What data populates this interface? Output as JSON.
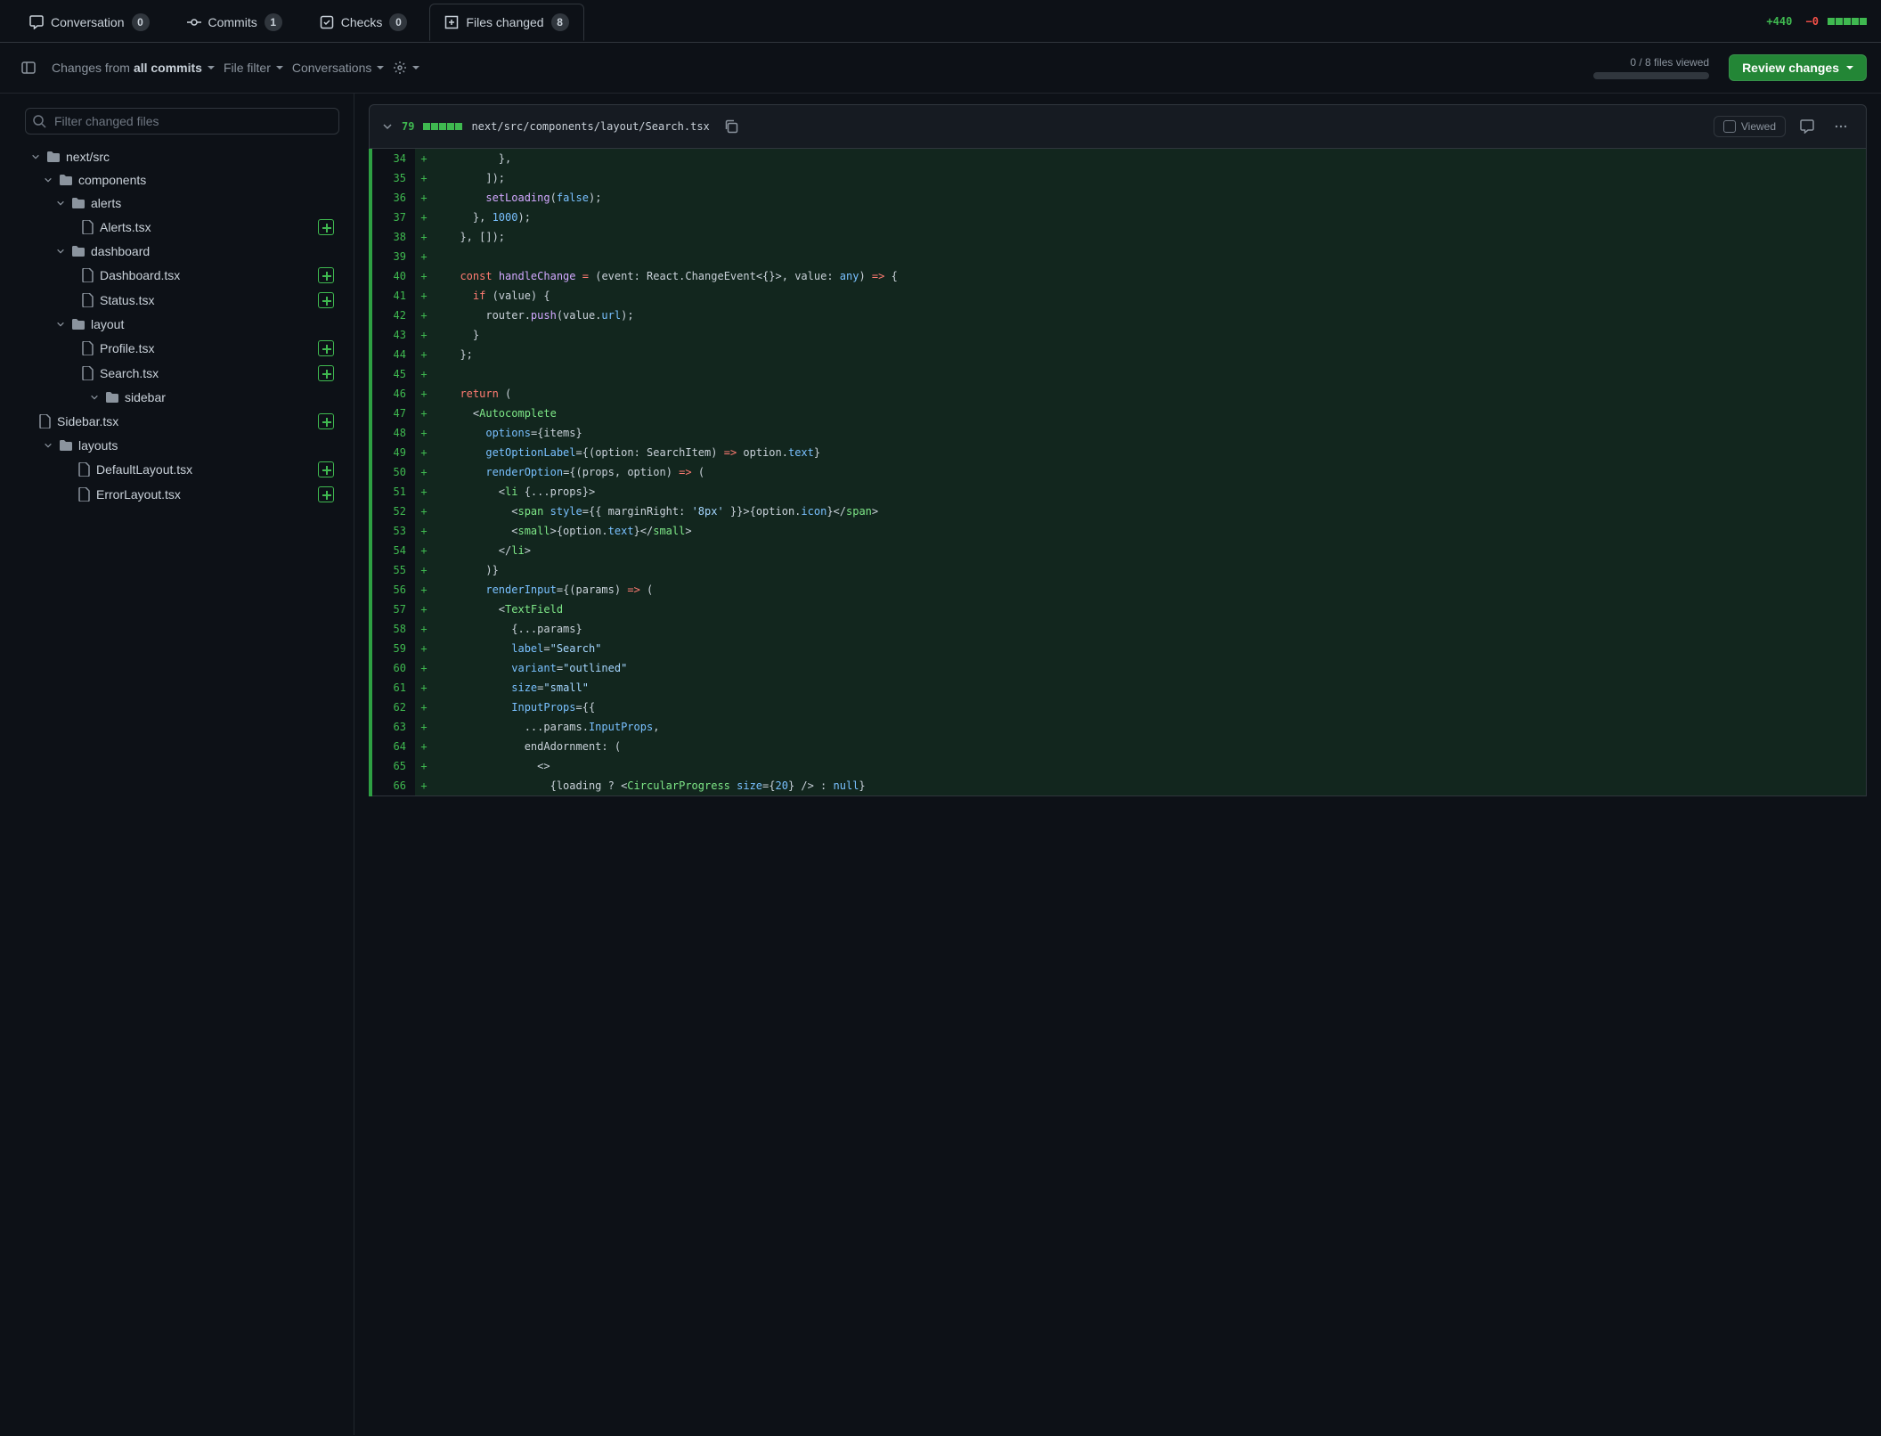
{
  "tabs": {
    "conversation": {
      "label": "Conversation",
      "count": "0"
    },
    "commits": {
      "label": "Commits",
      "count": "1"
    },
    "checks": {
      "label": "Checks",
      "count": "0"
    },
    "files": {
      "label": "Files changed",
      "count": "8"
    }
  },
  "diffstat": {
    "add": "+440",
    "del": "−0"
  },
  "toolbar": {
    "changes_from_label": "Changes from ",
    "changes_from_value": "all commits",
    "file_filter": "File filter",
    "conversations": "Conversations",
    "progress": "0 / 8 files viewed",
    "review": "Review changes"
  },
  "filter": {
    "placeholder": "Filter changed files"
  },
  "tree": [
    {
      "depth": "d1",
      "type": "dir",
      "name": "next/src"
    },
    {
      "depth": "d2",
      "type": "dir",
      "name": "components"
    },
    {
      "depth": "d3",
      "type": "dir",
      "name": "alerts"
    },
    {
      "depth": "d4",
      "type": "file",
      "name": "Alerts.tsx",
      "badge": true
    },
    {
      "depth": "d3",
      "type": "dir",
      "name": "dashboard"
    },
    {
      "depth": "d4",
      "type": "file",
      "name": "Dashboard.tsx",
      "badge": true
    },
    {
      "depth": "d4",
      "type": "file",
      "name": "Status.tsx",
      "badge": true
    },
    {
      "depth": "d3",
      "type": "dir",
      "name": "layout"
    },
    {
      "depth": "d4",
      "type": "file",
      "name": "Profile.tsx",
      "badge": true
    },
    {
      "depth": "d4",
      "type": "file",
      "name": "Search.tsx",
      "badge": true
    },
    {
      "depth": "d4f",
      "type": "dir",
      "name": "sidebar"
    },
    {
      "depth": "d4",
      "type": "file",
      "name": "Sidebar.tsx",
      "badge": true,
      "extra_indent": 14
    },
    {
      "depth": "d2",
      "type": "dir",
      "name": "layouts"
    },
    {
      "depth": "d3f",
      "type": "file",
      "name": "DefaultLayout.tsx",
      "badge": true
    },
    {
      "depth": "d3f",
      "type": "file",
      "name": "ErrorLayout.tsx",
      "badge": true
    }
  ],
  "file_header": {
    "lines": "79",
    "path": "next/src/components/layout/Search.tsx",
    "viewed_label": "Viewed"
  },
  "code": [
    {
      "n": "34",
      "h": "        },"
    },
    {
      "n": "35",
      "h": "      ]);"
    },
    {
      "n": "36",
      "h": "      <span class=fn>setLoading</span>(<span class=bool>false</span>);"
    },
    {
      "n": "37",
      "h": "    }, <span class=num>1000</span>);"
    },
    {
      "n": "38",
      "h": "  }, []);"
    },
    {
      "n": "39",
      "h": ""
    },
    {
      "n": "40",
      "h": "  <span class=kw>const</span> <span class=fn>handleChange</span> <span class=op>=</span> (<span class=var>event</span>: React.ChangeEvent&lt;{}&gt;, <span class=var>value</span>: <span class=prop>any</span>) <span class=op>=&gt;</span> {"
    },
    {
      "n": "41",
      "h": "    <span class=kw>if</span> (value) {"
    },
    {
      "n": "42",
      "h": "      router.<span class=fn>push</span>(value.<span class=prop>url</span>);"
    },
    {
      "n": "43",
      "h": "    }"
    },
    {
      "n": "44",
      "h": "  };"
    },
    {
      "n": "45",
      "h": ""
    },
    {
      "n": "46",
      "h": "  <span class=kw>return</span> ("
    },
    {
      "n": "47",
      "h": "    &lt;<span class=tag>Autocomplete</span>"
    },
    {
      "n": "48",
      "h": "      <span class=attr>options</span>={items}"
    },
    {
      "n": "49",
      "h": "      <span class=attr>getOptionLabel</span>={(<span class=var>option</span>: SearchItem) <span class=op>=&gt;</span> option.<span class=prop>text</span>}"
    },
    {
      "n": "50",
      "h": "      <span class=attr>renderOption</span>={(<span class=var>props</span>, <span class=var>option</span>) <span class=op>=&gt;</span> ("
    },
    {
      "n": "51",
      "h": "        &lt;<span class=tag>li</span> {...props}&gt;"
    },
    {
      "n": "52",
      "h": "          &lt;<span class=tag>span</span> <span class=attr>style</span>={{ marginRight: <span class=str>'8px'</span> }}&gt;{option.<span class=prop>icon</span>}&lt;/<span class=tag>span</span>&gt;"
    },
    {
      "n": "53",
      "h": "          &lt;<span class=tag>small</span>&gt;{option.<span class=prop>text</span>}&lt;/<span class=tag>small</span>&gt;"
    },
    {
      "n": "54",
      "h": "        &lt;/<span class=tag>li</span>&gt;"
    },
    {
      "n": "55",
      "h": "      )}"
    },
    {
      "n": "56",
      "h": "      <span class=attr>renderInput</span>={(<span class=var>params</span>) <span class=op>=&gt;</span> ("
    },
    {
      "n": "57",
      "h": "        &lt;<span class=tag>TextField</span>"
    },
    {
      "n": "58",
      "h": "          {...params}"
    },
    {
      "n": "59",
      "h": "          <span class=attr>label</span>=<span class=str>\"Search\"</span>"
    },
    {
      "n": "60",
      "h": "          <span class=attr>variant</span>=<span class=str>\"outlined\"</span>"
    },
    {
      "n": "61",
      "h": "          <span class=attr>size</span>=<span class=str>\"small\"</span>"
    },
    {
      "n": "62",
      "h": "          <span class=attr>InputProps</span>={{"
    },
    {
      "n": "63",
      "h": "            ...params.<span class=prop>InputProps</span>,"
    },
    {
      "n": "64",
      "h": "            endAdornment: ("
    },
    {
      "n": "65",
      "h": "              &lt;&gt;"
    },
    {
      "n": "66",
      "h": "                {loading ? &lt;<span class=tag>CircularProgress</span> <span class=attr>size</span>={<span class=num>20</span>} /&gt; : <span class=bool>null</span>}"
    }
  ]
}
